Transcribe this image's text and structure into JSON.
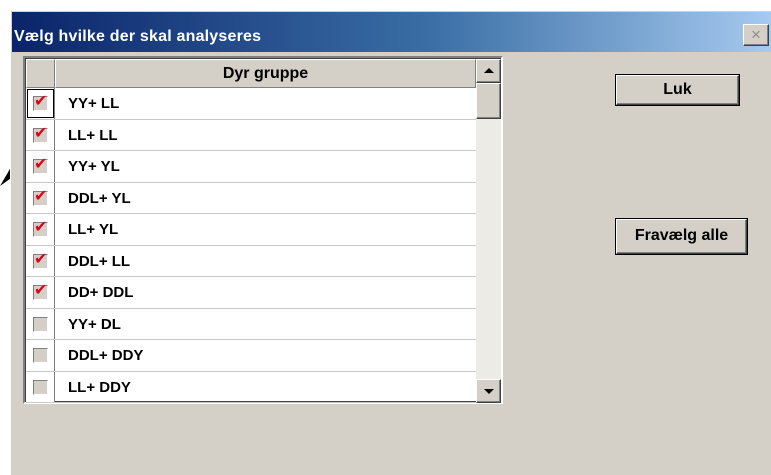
{
  "window": {
    "title": "Vælg hvilke der skal analyseres",
    "close_glyph": "×"
  },
  "grid": {
    "column_header": "Dyr gruppe",
    "rows": [
      {
        "label": "YY+ LL",
        "checked": true
      },
      {
        "label": "LL+ LL",
        "checked": true
      },
      {
        "label": "YY+ YL",
        "checked": true
      },
      {
        "label": "DDL+ YL",
        "checked": true
      },
      {
        "label": "LL+ YL",
        "checked": true
      },
      {
        "label": "DDL+ LL",
        "checked": true
      },
      {
        "label": "DD+ DDL",
        "checked": true
      },
      {
        "label": "YY+ DL",
        "checked": false
      },
      {
        "label": "DDL+ DDY",
        "checked": false
      },
      {
        "label": "LL+ DDY",
        "checked": false
      }
    ],
    "check_glyph": "✔",
    "check_color": "#e0001b"
  },
  "buttons": {
    "close_label": "Luk",
    "deselect_all_label": "Fravælg alle"
  },
  "icons": {
    "close": "close-icon",
    "scroll_up": "scroll-up-arrow-icon",
    "scroll_down": "scroll-down-arrow-icon",
    "pointer": "annotation-arrow-icon"
  }
}
